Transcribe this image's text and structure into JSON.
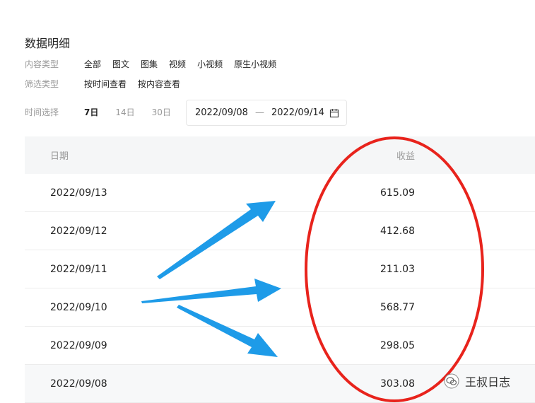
{
  "title": "数据明细",
  "content_type": {
    "label": "内容类型",
    "options": [
      "全部",
      "图文",
      "图集",
      "视频",
      "小视频",
      "原生小视频"
    ]
  },
  "filter_type": {
    "label": "筛选类型",
    "options": [
      "按时间查看",
      "按内容查看"
    ]
  },
  "time_select": {
    "label": "时间选择",
    "options": [
      "7日",
      "14日",
      "30日"
    ],
    "active": "7日"
  },
  "date_range": {
    "start": "2022/09/08",
    "separator": "—",
    "end": "2022/09/14"
  },
  "table": {
    "headers": {
      "date": "日期",
      "revenue": "收益"
    },
    "rows": [
      {
        "date": "2022/09/13",
        "revenue": "615.09"
      },
      {
        "date": "2022/09/12",
        "revenue": "412.68"
      },
      {
        "date": "2022/09/11",
        "revenue": "211.03"
      },
      {
        "date": "2022/09/10",
        "revenue": "568.77"
      },
      {
        "date": "2022/09/09",
        "revenue": "298.05"
      },
      {
        "date": "2022/09/08",
        "revenue": "303.08"
      }
    ]
  },
  "annotation": {
    "circle_color": "#e8231c",
    "arrow_color": "#1e9be8"
  },
  "watermark": {
    "text": "王叔日志",
    "icon": "wechat-icon"
  }
}
